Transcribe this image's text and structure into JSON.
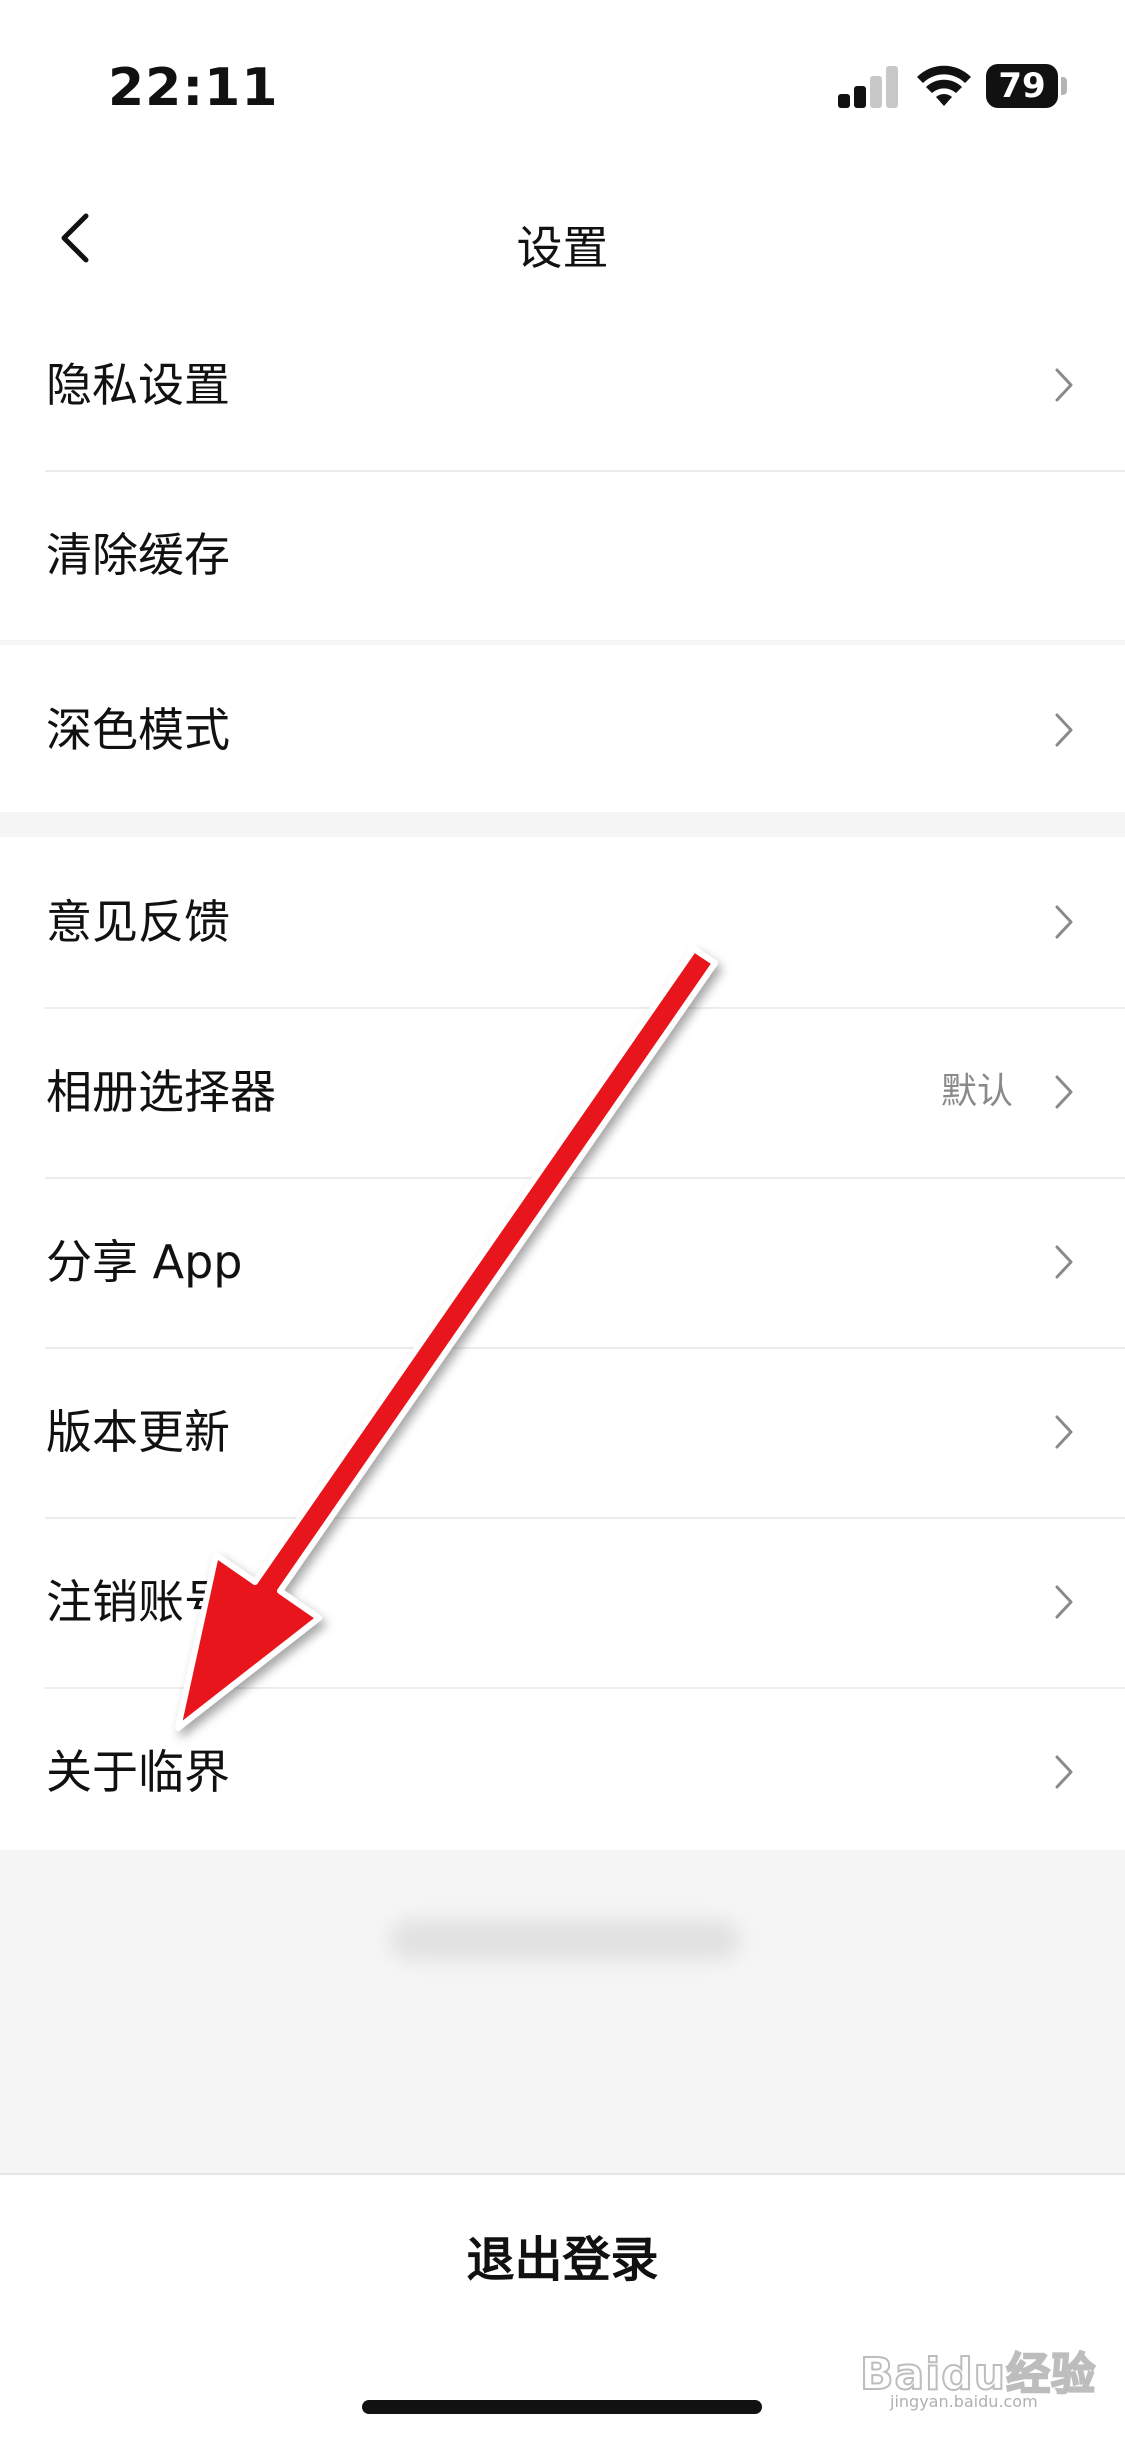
{
  "status_bar": {
    "time": "22:11",
    "battery": "79"
  },
  "nav": {
    "title": "设置"
  },
  "groups": [
    {
      "items": [
        {
          "label": "隐私设置",
          "chevron": true
        },
        {
          "label": "清除缓存",
          "chevron": false
        }
      ]
    },
    {
      "items": [
        {
          "label": "深色模式",
          "chevron": true
        }
      ]
    },
    {
      "items": [
        {
          "label": "意见反馈",
          "chevron": true
        },
        {
          "label": "相册选择器",
          "value": "默认",
          "chevron": true
        },
        {
          "label": "分享 App",
          "chevron": true
        },
        {
          "label": "版本更新",
          "chevron": true
        },
        {
          "label": "注销账号",
          "chevron": true
        },
        {
          "label": "关于临界",
          "chevron": true
        }
      ]
    }
  ],
  "logout_label": "退出登录",
  "watermark": {
    "text": "Baidu经验",
    "url": "jingyan.baidu.com"
  },
  "colors": {
    "annotation_arrow": "#e8141b",
    "separator": "#ececec",
    "section_gap": "#f5f5f5"
  }
}
